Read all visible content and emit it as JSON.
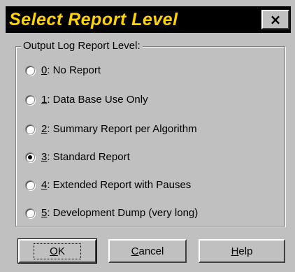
{
  "dialog": {
    "title": "Select Report Level",
    "close_glyph": "×",
    "group_label": "Output Log Report Level:",
    "options": [
      {
        "key": "0",
        "rest": ": No Report",
        "checked": false
      },
      {
        "key": "1",
        "rest": ": Data Base Use Only",
        "checked": false
      },
      {
        "key": "2",
        "rest": ": Summary Report per Algorithm",
        "checked": false
      },
      {
        "key": "3",
        "rest": ": Standard Report",
        "checked": true
      },
      {
        "key": "4",
        "rest": ": Extended Report with Pauses",
        "checked": false
      },
      {
        "key": "5",
        "rest": ": Development Dump (very long)",
        "checked": false
      }
    ],
    "buttons": {
      "ok": {
        "key": "O",
        "rest": "K"
      },
      "cancel": {
        "key": "C",
        "rest": "ancel"
      },
      "help": {
        "key": "H",
        "rest": "elp"
      }
    }
  },
  "colors": {
    "title_bar": "#000000",
    "title_text": "#ffd200",
    "face": "#c0c0c0"
  },
  "icons": {
    "close": "close-icon"
  }
}
